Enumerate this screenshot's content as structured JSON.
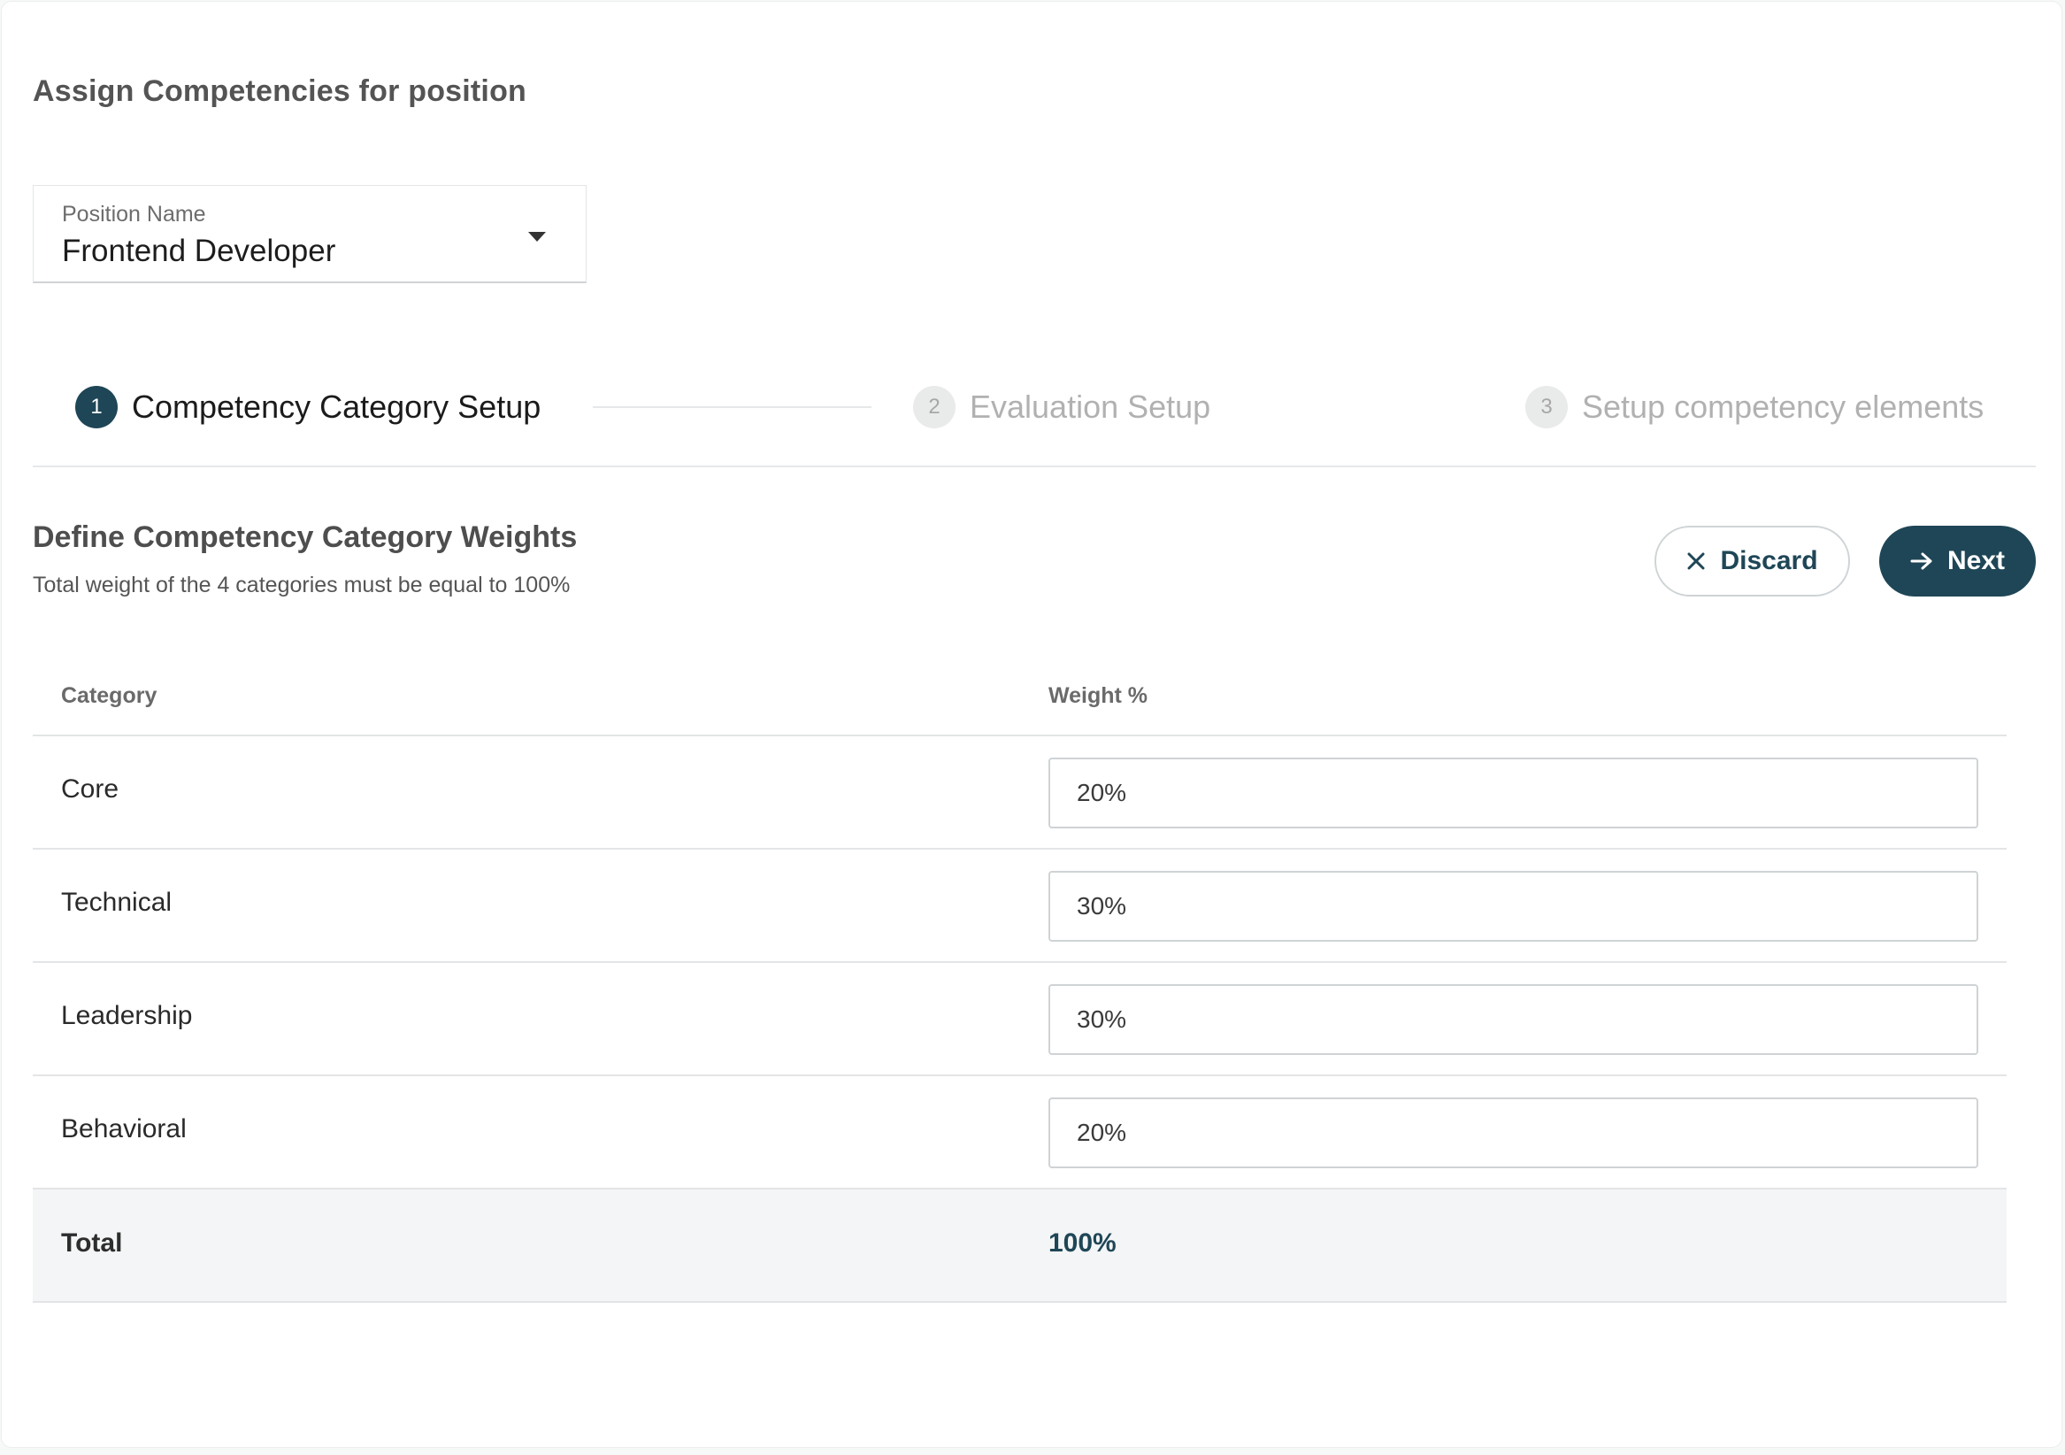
{
  "header": {
    "title": "Assign Competencies for position"
  },
  "position_select": {
    "label": "Position Name",
    "value": "Frontend Developer"
  },
  "stepper": {
    "steps": [
      {
        "number": "1",
        "label": "Competency Category Setup",
        "state": "active"
      },
      {
        "number": "2",
        "label": "Evaluation Setup",
        "state": "inactive"
      },
      {
        "number": "3",
        "label": "Setup competency elements",
        "state": "inactive"
      }
    ]
  },
  "section": {
    "title": "Define Competency Category Weights",
    "subtitle": "Total weight of the 4 categories must be equal to 100%"
  },
  "actions": {
    "discard_label": "Discard",
    "next_label": "Next"
  },
  "table": {
    "headers": {
      "category": "Category",
      "weight": "Weight %"
    },
    "rows": [
      {
        "category": "Core",
        "weight": "20%"
      },
      {
        "category": "Technical",
        "weight": "30%"
      },
      {
        "category": "Leadership",
        "weight": "30%"
      },
      {
        "category": "Behavioral",
        "weight": "20%"
      }
    ],
    "total": {
      "label": "Total",
      "value": "100%"
    }
  },
  "colors": {
    "primary": "#1f4656",
    "muted_text": "#b1b1b1",
    "border": "#e3e5e6"
  }
}
